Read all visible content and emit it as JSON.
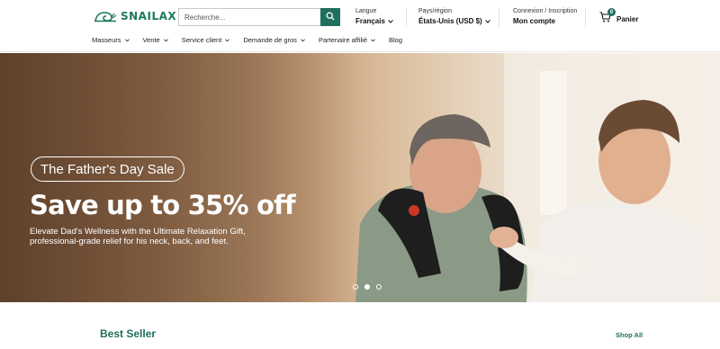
{
  "header": {
    "brand": "SNAILAX",
    "search": {
      "placeholder": "Recherche..."
    },
    "language": {
      "label": "Langue",
      "value": "Français"
    },
    "region": {
      "label": "Pays/région",
      "value": "États-Unis (USD $)"
    },
    "account": {
      "label": "Connexion / Inscription",
      "value": "Mon compte"
    },
    "cart": {
      "count": "0",
      "label": "Panier"
    }
  },
  "nav": {
    "items": [
      {
        "label": "Masseurs"
      },
      {
        "label": "Vente"
      },
      {
        "label": "Service client"
      },
      {
        "label": "Demande de gros"
      },
      {
        "label": "Partenaire affilié"
      },
      {
        "label": "Blog"
      }
    ]
  },
  "hero": {
    "badge": "The Father's Day Sale",
    "headline": "Save up to 35% off",
    "subline_1": "Elevate Dad's Wellness with the Ultimate Relaxation Gift,",
    "subline_2": "professional-grade relief for his neck, back, and feet.",
    "slide_count": 3,
    "active_slide": 2
  },
  "sections": {
    "best_seller": {
      "title": "Best Seller",
      "link": "Shop All"
    }
  },
  "colors": {
    "brand_green": "#1f6f5c",
    "logo_green": "#1f7a5c"
  },
  "icons": {
    "search": "search-icon",
    "cart": "cart-icon",
    "chevron": "chevron-down-icon",
    "logo": "snail-logo-icon"
  }
}
